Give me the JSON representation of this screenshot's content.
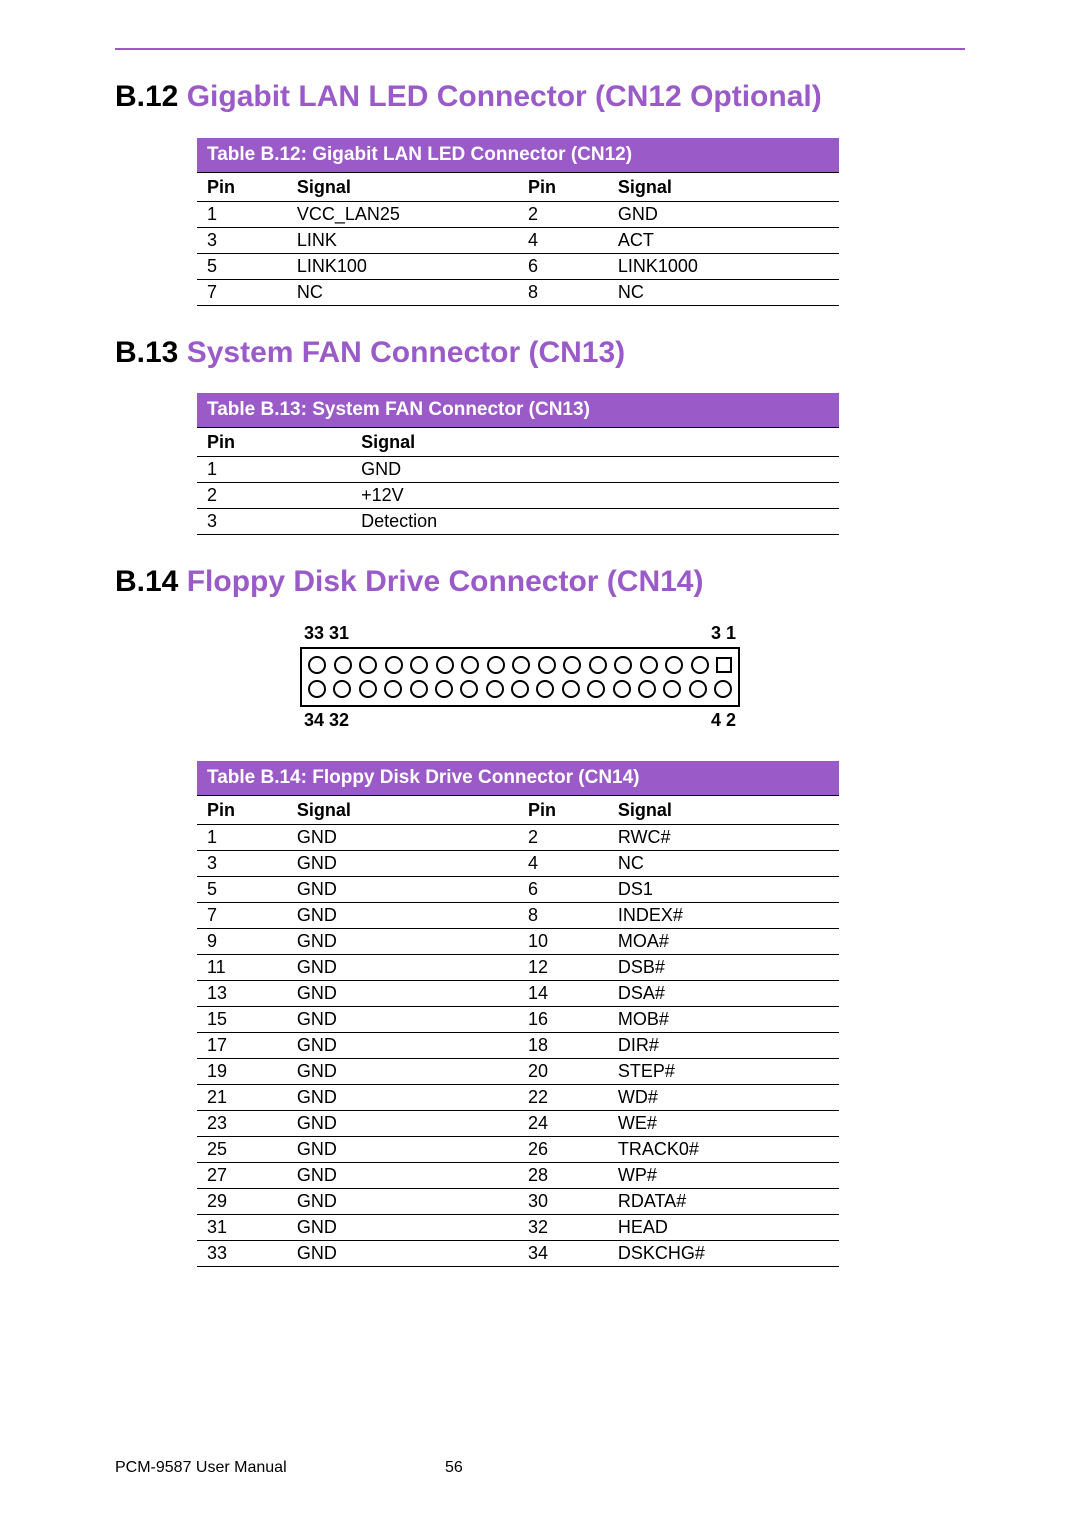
{
  "sections": {
    "s12": {
      "num": "B.12",
      "title": "Gigabit LAN LED Connector (CN12 Optional)"
    },
    "s13": {
      "num": "B.13",
      "title": "System FAN Connector (CN13)"
    },
    "s14": {
      "num": "B.14",
      "title": "Floppy Disk Drive Connector (CN14)"
    }
  },
  "tables": {
    "t12": {
      "caption": "Table B.12: Gigabit LAN LED Connector (CN12)",
      "headers": [
        "Pin",
        "Signal",
        "Pin",
        "Signal"
      ],
      "rows": [
        [
          "1",
          "VCC_LAN25",
          "2",
          "GND"
        ],
        [
          "3",
          "LINK",
          "4",
          "ACT"
        ],
        [
          "5",
          "LINK100",
          "6",
          "LINK1000"
        ],
        [
          "7",
          "NC",
          "8",
          "NC"
        ]
      ]
    },
    "t13": {
      "caption": "Table B.13: System FAN Connector (CN13)",
      "headers": [
        "Pin",
        "Signal"
      ],
      "rows": [
        [
          "1",
          "GND"
        ],
        [
          "2",
          "+12V"
        ],
        [
          "3",
          "Detection"
        ]
      ]
    },
    "t14": {
      "caption": "Table B.14: Floppy Disk Drive Connector (CN14)",
      "headers": [
        "Pin",
        "Signal",
        "Pin",
        "Signal"
      ],
      "rows": [
        [
          "1",
          "GND",
          "2",
          "RWC#"
        ],
        [
          "3",
          "GND",
          "4",
          "NC"
        ],
        [
          "5",
          "GND",
          "6",
          "DS1"
        ],
        [
          "7",
          "GND",
          "8",
          "INDEX#"
        ],
        [
          "9",
          "GND",
          "10",
          "MOA#"
        ],
        [
          "11",
          "GND",
          "12",
          "DSB#"
        ],
        [
          "13",
          "GND",
          "14",
          "DSA#"
        ],
        [
          "15",
          "GND",
          "16",
          "MOB#"
        ],
        [
          "17",
          "GND",
          "18",
          "DIR#"
        ],
        [
          "19",
          "GND",
          "20",
          "STEP#"
        ],
        [
          "21",
          "GND",
          "22",
          "WD#"
        ],
        [
          "23",
          "GND",
          "24",
          "WE#"
        ],
        [
          "25",
          "GND",
          "26",
          "TRACK0#"
        ],
        [
          "27",
          "GND",
          "28",
          "WP#"
        ],
        [
          "29",
          "GND",
          "30",
          "RDATA#"
        ],
        [
          "31",
          "GND",
          "32",
          "HEAD"
        ],
        [
          "33",
          "GND",
          "34",
          "DSKCHG#"
        ]
      ]
    }
  },
  "connector_diagram": {
    "top_left": "33 31",
    "top_right": "3  1",
    "bot_left": "34 32",
    "bot_right": "4  2",
    "cols": 17,
    "pin1_square": true
  },
  "footer": {
    "manual": "PCM-9587 User Manual",
    "page": "56"
  }
}
